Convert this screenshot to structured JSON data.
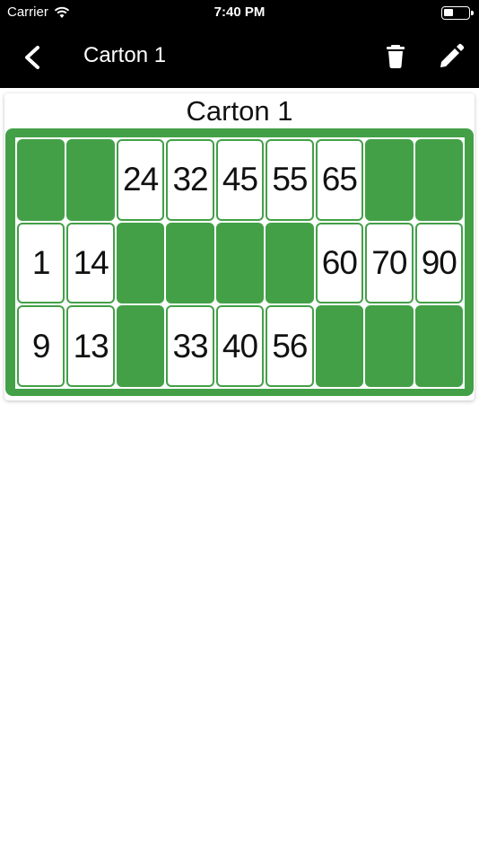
{
  "status_bar": {
    "carrier": "Carrier",
    "time": "7:40 PM",
    "battery_level": 0.4
  },
  "nav_bar": {
    "title": "Carton 1",
    "icons": [
      "chevron-left-icon",
      "trash-icon",
      "pencil-icon"
    ]
  },
  "card": {
    "title": "Carton 1",
    "accent_color": "#43a047",
    "rows": [
      [
        "",
        "",
        "24",
        "32",
        "45",
        "55",
        "65",
        "",
        ""
      ],
      [
        "1",
        "14",
        "",
        "",
        "",
        "",
        "60",
        "70",
        "90"
      ],
      [
        "9",
        "13",
        "",
        "33",
        "40",
        "56",
        "",
        "",
        ""
      ]
    ]
  }
}
